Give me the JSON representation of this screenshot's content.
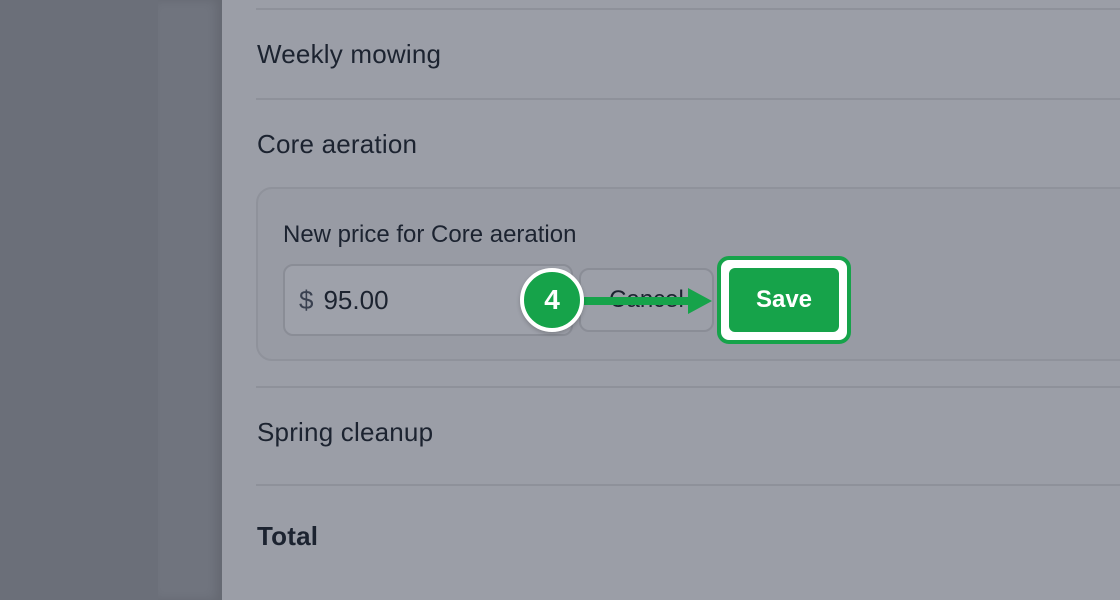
{
  "services": [
    {
      "label": "Weekly mowing"
    },
    {
      "label": "Core aeration"
    },
    {
      "label": "Spring cleanup"
    }
  ],
  "total_label": "Total",
  "edit": {
    "title": "New price for Core aeration",
    "currency_symbol": "$",
    "price_value": "95.00",
    "cancel_label": "Cancel",
    "save_label": "Save"
  },
  "annotation": {
    "step_number": "4"
  },
  "colors": {
    "accent": "#16a34a",
    "text": "#1c2330"
  }
}
